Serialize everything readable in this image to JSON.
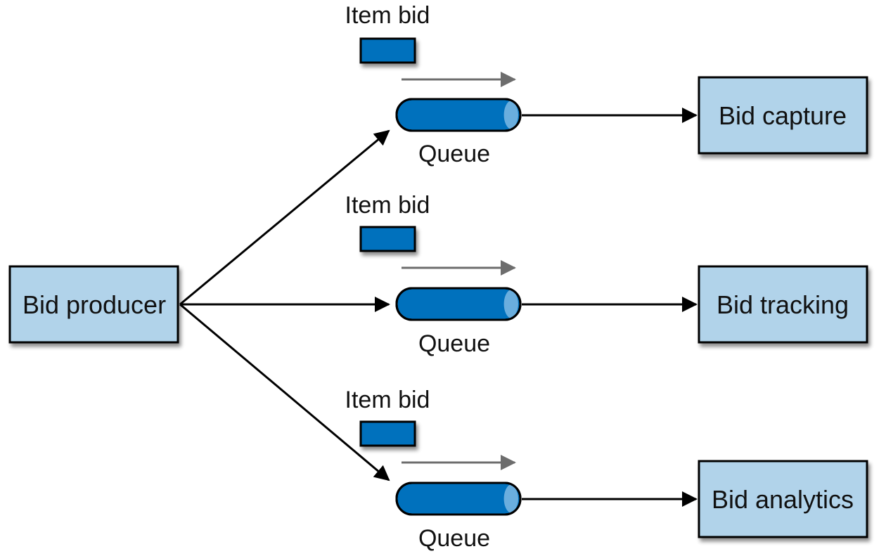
{
  "colors": {
    "box_fill": "#b1d3ea",
    "queue_fill": "#0071bd",
    "queue_cap": "#6aaede",
    "item_fill": "#0071bd",
    "flow_arrow": "#6d6d6d",
    "line": "#000000"
  },
  "producer": {
    "label": "Bid producer"
  },
  "lanes": [
    {
      "item_label": "Item bid",
      "queue_label": "Queue",
      "consumer_label": "Bid capture"
    },
    {
      "item_label": "Item bid",
      "queue_label": "Queue",
      "consumer_label": "Bid tracking"
    },
    {
      "item_label": "Item bid",
      "queue_label": "Queue",
      "consumer_label": "Bid analytics"
    }
  ]
}
